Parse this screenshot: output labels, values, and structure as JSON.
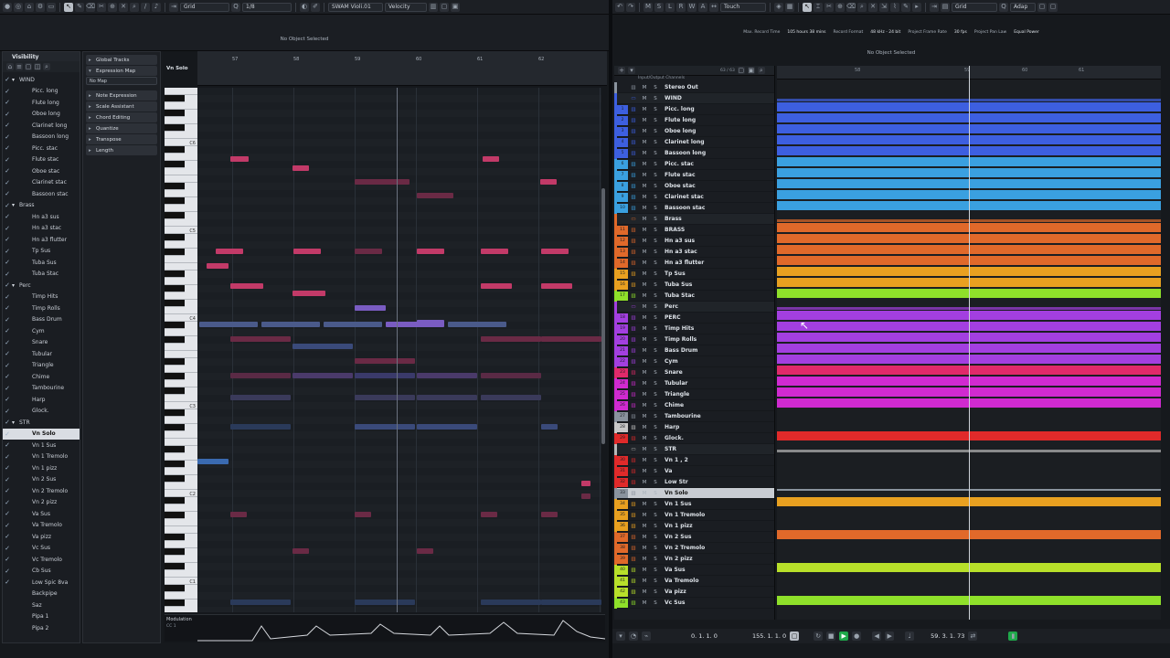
{
  "left": {
    "toolbar": {
      "grid_label": "Grid",
      "quantize": "1/8",
      "instrument": "SWAM Violi.01",
      "velocity_label": "Velocity"
    },
    "status": "No Object Selected",
    "visibility_tab": "Visibility",
    "visibility": [
      {
        "label": "WIND",
        "folder": true,
        "checked": true
      },
      {
        "label": "Picc. long",
        "checked": true
      },
      {
        "label": "Flute long",
        "checked": true
      },
      {
        "label": "Oboe long",
        "checked": true
      },
      {
        "label": "Clarinet long",
        "checked": true
      },
      {
        "label": "Bassoon long",
        "checked": true
      },
      {
        "label": "Picc. stac",
        "checked": true
      },
      {
        "label": "Flute stac",
        "checked": true
      },
      {
        "label": "Oboe stac",
        "checked": true
      },
      {
        "label": "Clarinet stac",
        "checked": true
      },
      {
        "label": "Bassoon stac",
        "checked": true
      },
      {
        "label": "Brass",
        "folder": true,
        "checked": true
      },
      {
        "label": "Hn a3 sus",
        "checked": true
      },
      {
        "label": "Hn a3 stac",
        "checked": true
      },
      {
        "label": "Hn a3 flutter",
        "checked": true
      },
      {
        "label": "Tp Sus",
        "checked": true
      },
      {
        "label": "Tuba Sus",
        "checked": true
      },
      {
        "label": "Tuba Stac",
        "checked": true
      },
      {
        "label": "Perc",
        "folder": true,
        "checked": true
      },
      {
        "label": "Timp Hits",
        "checked": true
      },
      {
        "label": "Timp Rolls",
        "checked": true
      },
      {
        "label": "Bass Drum",
        "checked": true
      },
      {
        "label": "Cym",
        "checked": true
      },
      {
        "label": "Snare",
        "checked": true
      },
      {
        "label": "Tubular",
        "checked": true
      },
      {
        "label": "Triangle",
        "checked": true
      },
      {
        "label": "Chime",
        "checked": true
      },
      {
        "label": "Tambourine",
        "checked": true
      },
      {
        "label": "Harp",
        "checked": true
      },
      {
        "label": "Glock.",
        "checked": true
      },
      {
        "label": "STR",
        "folder": true,
        "checked": true
      },
      {
        "label": "Vn Solo",
        "checked": true,
        "selected": true
      },
      {
        "label": "Vn 1 Sus",
        "checked": true
      },
      {
        "label": "Vn 1 Tremolo",
        "checked": true
      },
      {
        "label": "Vn 1 pizz",
        "checked": true
      },
      {
        "label": "Vn 2 Sus",
        "checked": true
      },
      {
        "label": "Vn 2 Tremolo",
        "checked": true
      },
      {
        "label": "Vn 2 pizz",
        "checked": true
      },
      {
        "label": "Va Sus",
        "checked": true
      },
      {
        "label": "Va Tremolo",
        "checked": true
      },
      {
        "label": "Va pizz",
        "checked": true
      },
      {
        "label": "Vc Sus",
        "checked": true
      },
      {
        "label": "Vc Tremolo",
        "checked": true
      },
      {
        "label": "Cb Sus",
        "checked": true
      },
      {
        "label": "Low Spic 8va",
        "checked": true
      },
      {
        "label": "Backpipe",
        "checked": false
      },
      {
        "label": "Saz",
        "checked": false
      },
      {
        "label": "Pipa 1",
        "checked": false
      },
      {
        "label": "Pipa 2",
        "checked": false
      }
    ],
    "inspector": {
      "global_tracks": "Global Tracks",
      "expression_map": "Expression Map",
      "no_map": "No Map",
      "items": [
        "Note Expression",
        "Scale Assistant",
        "Chord Editing",
        "Quantize",
        "Transpose",
        "Length"
      ]
    },
    "editor": {
      "track_name": "Vn Solo",
      "bars": [
        "57",
        "58",
        "59",
        "60",
        "61",
        "62"
      ],
      "octaves": [
        "C6",
        "C5",
        "C4",
        "C3",
        "C2",
        "C1"
      ],
      "controller_lane": "Modulation",
      "controller_sub": "CC 1"
    }
  },
  "right": {
    "toolbar": {
      "mode": "Touch",
      "grid_label": "Grid",
      "adapt": "Adap"
    },
    "info_bar": [
      "Max. Record Time",
      "105 hours 38 mins",
      "Record Format",
      "48 kHz - 24 bit",
      "Project Frame Rate",
      "30 fps",
      "Project Pan Law",
      "Equal Power"
    ],
    "status": "No Object Selected",
    "track_count": "63 / 63",
    "io_label": "Input/Output Channels",
    "tracks": [
      {
        "num": "",
        "name": "Stereo Out",
        "color": "#8a939e",
        "type": "out"
      },
      {
        "num": "",
        "name": "WIND",
        "color": "#3d5fe0",
        "type": "folder"
      },
      {
        "num": "1",
        "name": "Picc. long",
        "color": "#3d5fe0",
        "type": "inst"
      },
      {
        "num": "2",
        "name": "Flute long",
        "color": "#3d5fe0",
        "type": "inst"
      },
      {
        "num": "3",
        "name": "Oboe long",
        "color": "#3d5fe0",
        "type": "inst"
      },
      {
        "num": "4",
        "name": "Clarinet long",
        "color": "#3d5fe0",
        "type": "inst"
      },
      {
        "num": "5",
        "name": "Bassoon long",
        "color": "#3d5fe0",
        "type": "inst"
      },
      {
        "num": "6",
        "name": "Picc. stac",
        "color": "#3aa0e0",
        "type": "inst"
      },
      {
        "num": "7",
        "name": "Flute stac",
        "color": "#3aa0e0",
        "type": "inst"
      },
      {
        "num": "8",
        "name": "Oboe stac",
        "color": "#3aa0e0",
        "type": "inst"
      },
      {
        "num": "9",
        "name": "Clarinet stac",
        "color": "#3aa0e0",
        "type": "inst"
      },
      {
        "num": "10",
        "name": "Bassoon stac",
        "color": "#3aa0e0",
        "type": "inst"
      },
      {
        "num": "",
        "name": "Brass",
        "color": "#e0692a",
        "type": "folder"
      },
      {
        "num": "11",
        "name": "BRASS",
        "color": "#e0692a",
        "type": "inst"
      },
      {
        "num": "12",
        "name": "Hn a3 sus",
        "color": "#e0692a",
        "type": "inst"
      },
      {
        "num": "13",
        "name": "Hn a3 stac",
        "color": "#e0692a",
        "type": "inst"
      },
      {
        "num": "14",
        "name": "Hn a3 flutter",
        "color": "#e0692a",
        "type": "inst"
      },
      {
        "num": "15",
        "name": "Tp Sus",
        "color": "#e8a020",
        "type": "inst"
      },
      {
        "num": "16",
        "name": "Tuba Sus",
        "color": "#e8a020",
        "type": "inst"
      },
      {
        "num": "17",
        "name": "Tuba Stac",
        "color": "#8fe02a",
        "type": "inst"
      },
      {
        "num": "",
        "name": "Perc",
        "color": "#a33fe0",
        "type": "folder"
      },
      {
        "num": "18",
        "name": "PERC",
        "color": "#a33fe0",
        "type": "inst"
      },
      {
        "num": "19",
        "name": "Timp Hits",
        "color": "#a33fe0",
        "type": "inst"
      },
      {
        "num": "20",
        "name": "Timp Rolls",
        "color": "#a33fe0",
        "type": "inst"
      },
      {
        "num": "21",
        "name": "Bass Drum",
        "color": "#a33fe0",
        "type": "inst"
      },
      {
        "num": "22",
        "name": "Cym",
        "color": "#a33fe0",
        "type": "inst"
      },
      {
        "num": "23",
        "name": "Snare",
        "color": "#e02a6a",
        "type": "inst"
      },
      {
        "num": "24",
        "name": "Tubular",
        "color": "#d02ad0",
        "type": "inst"
      },
      {
        "num": "25",
        "name": "Triangle",
        "color": "#d02ad0",
        "type": "inst"
      },
      {
        "num": "26",
        "name": "Chime",
        "color": "#d02ad0",
        "type": "inst"
      },
      {
        "num": "27",
        "name": "Tambourine",
        "color": "#8a939e",
        "type": "inst"
      },
      {
        "num": "28",
        "name": "Harp",
        "color": "#c8c8c8",
        "type": "inst"
      },
      {
        "num": "29",
        "name": "Glock.",
        "color": "#e02a2a",
        "type": "inst"
      },
      {
        "num": "",
        "name": "STR",
        "color": "#b8b8b8",
        "type": "folder"
      },
      {
        "num": "30",
        "name": "Vn 1 , 2",
        "color": "#e02a2a",
        "type": "inst"
      },
      {
        "num": "31",
        "name": "Va",
        "color": "#e02a2a",
        "type": "inst"
      },
      {
        "num": "32",
        "name": "Low Str",
        "color": "#e02a2a",
        "type": "inst"
      },
      {
        "num": "33",
        "name": "Vn Solo",
        "color": "#8a939e",
        "type": "inst",
        "selected": true
      },
      {
        "num": "34",
        "name": "Vn 1 Sus",
        "color": "#e8a020",
        "type": "inst"
      },
      {
        "num": "35",
        "name": "Vn 1 Tremolo",
        "color": "#e8a020",
        "type": "inst"
      },
      {
        "num": "36",
        "name": "Vn 1 pizz",
        "color": "#e8a020",
        "type": "inst"
      },
      {
        "num": "37",
        "name": "Vn 2 Sus",
        "color": "#e0692a",
        "type": "inst"
      },
      {
        "num": "38",
        "name": "Vn 2 Tremolo",
        "color": "#e0692a",
        "type": "inst"
      },
      {
        "num": "39",
        "name": "Vn 2 pizz",
        "color": "#e0692a",
        "type": "inst"
      },
      {
        "num": "40",
        "name": "Va Sus",
        "color": "#b8e02a",
        "type": "inst"
      },
      {
        "num": "41",
        "name": "Va Tremolo",
        "color": "#b8e02a",
        "type": "inst"
      },
      {
        "num": "42",
        "name": "Va pizz",
        "color": "#b8e02a",
        "type": "inst"
      },
      {
        "num": "43",
        "name": "Vc Sus",
        "color": "#8fe02a",
        "type": "inst"
      }
    ],
    "transport": {
      "left_locator": "0. 1. 1. 0",
      "right_locator": "155. 1. 1. 0",
      "position": "59. 3. 1. 73"
    }
  }
}
